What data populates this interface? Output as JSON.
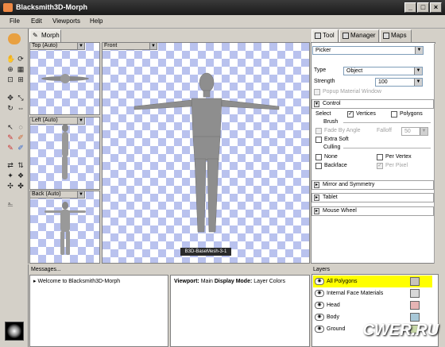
{
  "window": {
    "title": "Blacksmith3D-Morph"
  },
  "menu": [
    "File",
    "Edit",
    "Viewports",
    "Help"
  ],
  "left_tab": "Morph",
  "viewports": {
    "top": "Top (Auto)",
    "left": "Left (Auto)",
    "back": "Back (Auto)",
    "front": "Front"
  },
  "mesh_label": "B3D-BaseMesh-3-1",
  "right_tabs": [
    "Tool",
    "Manager",
    "Maps"
  ],
  "tool": {
    "name": "Picker",
    "type_label": "Type",
    "type_value": "Object",
    "strength_label": "Strength",
    "strength_value": "100",
    "popup_window": "Popup Material Window"
  },
  "control": {
    "header": "Control",
    "select_label": "Select",
    "vertices": "Vertices",
    "polygons": "Polygons",
    "brush_label": "Brush",
    "fade_by_angle": "Fade By Angle",
    "falloff_label": "Falloff",
    "falloff_value": "50",
    "extra_soft": "Extra Soft",
    "culling_label": "Culling",
    "none": "None",
    "per_vertex": "Per Vertex",
    "backface": "Backface",
    "per_pixel": "Per Pixel"
  },
  "sections": [
    "Mirror and Symmetry",
    "Tablet",
    "Mouse Wheel"
  ],
  "messages": {
    "title": "Messages...",
    "items": [
      "Welcome to Blacksmith3D-Morph"
    ]
  },
  "status": {
    "viewport_label": "Viewport:",
    "viewport_value": "Main",
    "mode_label": "Display Mode:",
    "mode_value": "Layer Colors"
  },
  "layers": {
    "title": "Layers",
    "items": [
      {
        "name": "All Polygons",
        "color": "#c8c4bc",
        "highlight": true
      },
      {
        "name": "Internal Face Materials",
        "color": "#d8d8d8"
      },
      {
        "name": "Head",
        "color": "#e6b4b4"
      },
      {
        "name": "Body",
        "color": "#a8c8d8"
      },
      {
        "name": "Ground",
        "color": "#c8d8a8"
      }
    ]
  },
  "watermark": "CWER.RU",
  "colors": {
    "layer_highlight": "#ffff00",
    "checker": "#b9c2ee"
  }
}
